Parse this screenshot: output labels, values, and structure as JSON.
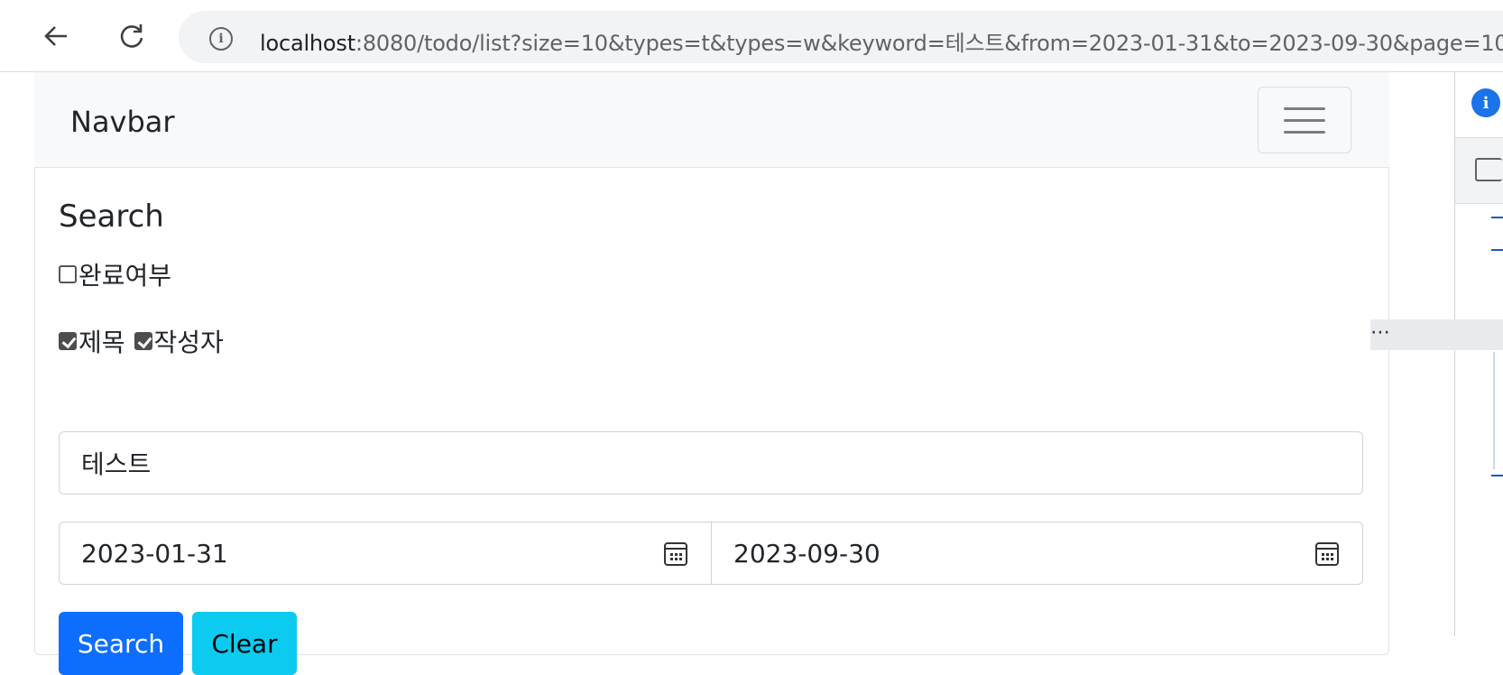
{
  "browser": {
    "url_host": "localhost",
    "url_rest": ":8080/todo/list?size=10&types=t&types=w&keyword=테스트&from=2023-01-31&to=2023-09-30&page=10",
    "back_icon": "arrow-left-icon",
    "reload_icon": "reload-icon",
    "info_icon": "info-icon"
  },
  "navbar": {
    "brand": "Navbar",
    "toggler_icon": "hamburger-icon"
  },
  "search": {
    "title": "Search",
    "finished_label": "완료여부",
    "finished_checked": false,
    "type_title_label": "제목",
    "type_title_checked": true,
    "type_writer_label": "작성자",
    "type_writer_checked": true,
    "keyword_value": "테스트",
    "from_date": "2023-01-31",
    "to_date": "2023-09-30",
    "search_button": "Search",
    "clear_button": "Clear"
  },
  "colors": {
    "primary": "#0d6efd",
    "info": "#0dcaf0",
    "navbar_bg": "#f8f9fa"
  }
}
